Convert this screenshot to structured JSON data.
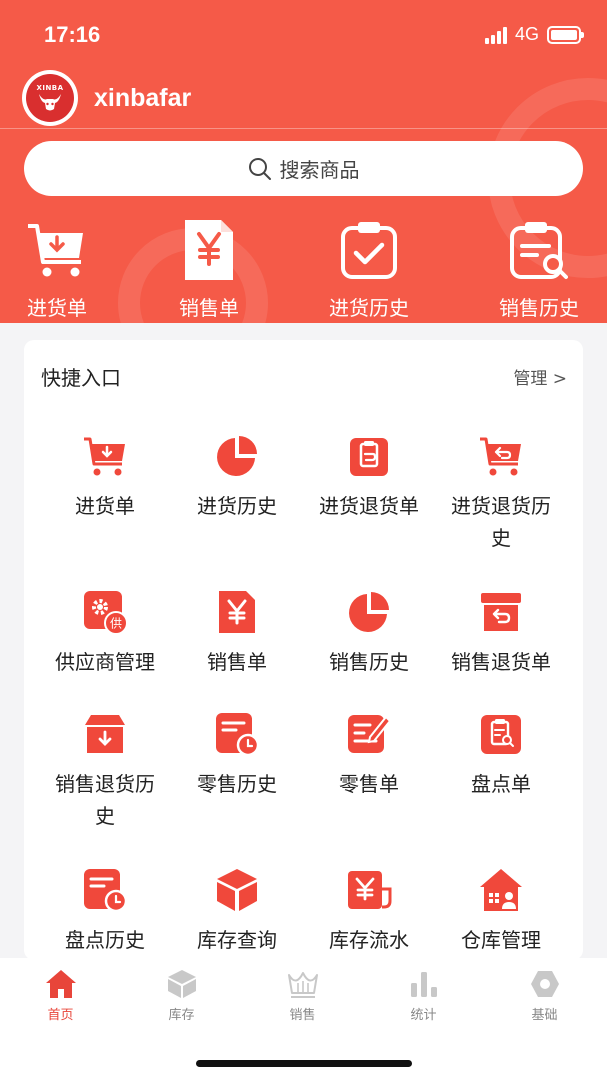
{
  "status_bar": {
    "time": "17:16",
    "network": "4G"
  },
  "profile": {
    "avatar_text": "XINBA",
    "username": "xinbafar"
  },
  "search": {
    "placeholder": "搜索商品"
  },
  "top_actions": [
    {
      "label": "进货单",
      "icon": "cart-download-icon"
    },
    {
      "label": "销售单",
      "icon": "yen-document-icon"
    },
    {
      "label": "进货历史",
      "icon": "clipboard-check-icon"
    },
    {
      "label": "销售历史",
      "icon": "document-search-icon"
    }
  ],
  "quick_entry": {
    "title": "快捷入口",
    "manage_label": "管理 >",
    "items": [
      {
        "label": "进货单",
        "icon": "cart-download-icon"
      },
      {
        "label": "进货历史",
        "icon": "pie-chart-icon"
      },
      {
        "label": "进货退货单",
        "icon": "clipboard-return-icon"
      },
      {
        "label": "进货退货历史",
        "icon": "cart-return-icon"
      },
      {
        "label": "供应商管理",
        "icon": "supplier-gear-icon"
      },
      {
        "label": "销售单",
        "icon": "yen-document-icon"
      },
      {
        "label": "销售历史",
        "icon": "pie-chart-icon"
      },
      {
        "label": "销售退货单",
        "icon": "box-return-icon"
      },
      {
        "label": "销售退货历史",
        "icon": "box-download-icon"
      },
      {
        "label": "零售历史",
        "icon": "document-clock-icon"
      },
      {
        "label": "零售单",
        "icon": "document-edit-icon"
      },
      {
        "label": "盘点单",
        "icon": "clipboard-search-icon"
      },
      {
        "label": "盘点历史",
        "icon": "document-clock-icon"
      },
      {
        "label": "库存查询",
        "icon": "cube-icon"
      },
      {
        "label": "库存流水",
        "icon": "yen-cup-icon"
      },
      {
        "label": "仓库管理",
        "icon": "warehouse-icon"
      }
    ]
  },
  "tabbar": [
    {
      "label": "首页",
      "icon": "home-icon",
      "active": true
    },
    {
      "label": "库存",
      "icon": "cube-icon",
      "active": false
    },
    {
      "label": "销售",
      "icon": "crown-icon",
      "active": false
    },
    {
      "label": "统计",
      "icon": "bar-chart-icon",
      "active": false
    },
    {
      "label": "基础",
      "icon": "hexagon-icon",
      "active": false
    }
  ],
  "colors": {
    "header": "#f55a48",
    "accent": "#f0483b",
    "tab_active": "#e8453a",
    "tab_inactive": "#c8c8c8"
  }
}
